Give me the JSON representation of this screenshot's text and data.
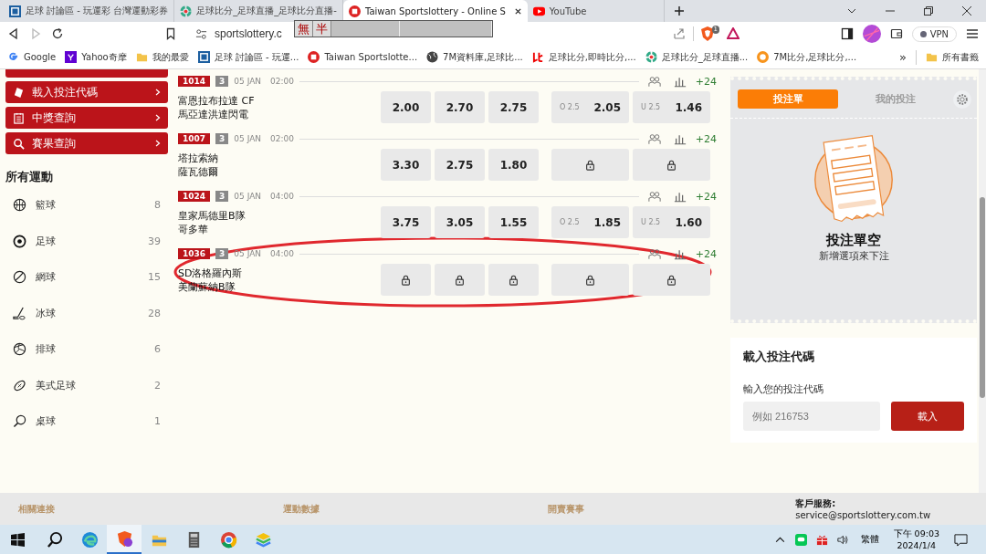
{
  "browser": {
    "tabs": [
      {
        "title": "足球 討論區 - 玩運彩 台灣運動彩券",
        "selected": false
      },
      {
        "title": "足球比分_足球直播_足球比分直播-",
        "selected": false
      },
      {
        "title": "Taiwan Sportslottery - Online S",
        "selected": true
      },
      {
        "title": "YouTube",
        "selected": false
      }
    ],
    "url": "sportslottery.c",
    "shield_count": "1",
    "vpn": "VPN",
    "ime": {
      "mode": "無",
      "width": "半"
    },
    "bookmarks": [
      {
        "label": "Google"
      },
      {
        "label": "Yahoo奇摩"
      },
      {
        "label": "我的最愛"
      },
      {
        "label": "足球 討論區 - 玩運..."
      },
      {
        "label": "Taiwan Sportslotte..."
      },
      {
        "label": "7M資料庫,足球比..."
      },
      {
        "label": "足球比分,即時比分,..."
      },
      {
        "label": "足球比分_足球直播..."
      },
      {
        "label": "7M比分,足球比分,..."
      }
    ],
    "more": "»",
    "all_bookmarks": "所有書籤"
  },
  "sidebar": {
    "menu": [
      {
        "label": "載入投注代碼"
      },
      {
        "label": "中獎查詢"
      },
      {
        "label": "賽果查詢"
      }
    ],
    "sports_title": "所有運動",
    "sports": [
      {
        "name": "籃球",
        "count": "8"
      },
      {
        "name": "足球",
        "count": "39"
      },
      {
        "name": "網球",
        "count": "15"
      },
      {
        "name": "冰球",
        "count": "28"
      },
      {
        "name": "排球",
        "count": "6"
      },
      {
        "name": "美式足球",
        "count": "2"
      },
      {
        "name": "桌球",
        "count": "1"
      }
    ]
  },
  "matches": [
    {
      "code": "1014",
      "tag": "3",
      "date": "05 JAN",
      "time": "02:00",
      "more": "+24",
      "teams": [
        "富恩拉布拉達 CF",
        "馬亞達洪達閃電"
      ],
      "odds": [
        {
          "kind": "odds",
          "value": "2.00"
        },
        {
          "kind": "odds",
          "value": "2.70"
        },
        {
          "kind": "odds",
          "value": "2.75"
        },
        {
          "kind": "line",
          "line": "O 2.5",
          "value": "2.05"
        },
        {
          "kind": "line",
          "line": "U 2.5",
          "value": "1.46"
        }
      ]
    },
    {
      "code": "1007",
      "tag": "3",
      "date": "05 JAN",
      "time": "02:00",
      "more": "+24",
      "teams": [
        "塔拉索納",
        "薩瓦德爾"
      ],
      "odds": [
        {
          "kind": "odds",
          "value": "3.30"
        },
        {
          "kind": "odds",
          "value": "2.75"
        },
        {
          "kind": "odds",
          "value": "1.80"
        },
        {
          "kind": "locked"
        },
        {
          "kind": "locked"
        }
      ]
    },
    {
      "code": "1024",
      "tag": "3",
      "date": "05 JAN",
      "time": "04:00",
      "more": "+24",
      "teams": [
        "皇家馬德里B隊",
        "哥多華"
      ],
      "odds": [
        {
          "kind": "odds",
          "value": "3.75"
        },
        {
          "kind": "odds",
          "value": "3.05"
        },
        {
          "kind": "odds",
          "value": "1.55"
        },
        {
          "kind": "line",
          "line": "O 2.5",
          "value": "1.85"
        },
        {
          "kind": "line",
          "line": "U 2.5",
          "value": "1.60"
        }
      ]
    },
    {
      "code": "1036",
      "tag": "3",
      "date": "05 JAN",
      "time": "04:00",
      "more": "+24",
      "teams": [
        "SD洛格羅內斯",
        "美蘭蘇納B隊"
      ],
      "odds": [
        {
          "kind": "locked"
        },
        {
          "kind": "locked"
        },
        {
          "kind": "locked"
        },
        {
          "kind": "locked"
        },
        {
          "kind": "locked"
        }
      ]
    }
  ],
  "betslip": {
    "tabs": [
      {
        "label": "投注單",
        "selected": true
      },
      {
        "label": "我的投注",
        "selected": false
      }
    ],
    "empty_title": "投注單空",
    "empty_text": "新增選項來下注",
    "code_title": "載入投注代碼",
    "code_label": "輸入您的投注代碼",
    "code_placeholder": "例如 216753",
    "load_button": "載入"
  },
  "footer": {
    "headings": [
      "相關連接",
      "運動數據",
      "開賣賽事"
    ],
    "service_label": "客戶服務:",
    "service_email": "service@sportslottery.com.tw"
  },
  "taskbar": {
    "apps": [
      {
        "active": false
      },
      {
        "active": false
      },
      {
        "active": true
      },
      {
        "active": false
      },
      {
        "active": false
      },
      {
        "active": false
      },
      {
        "active": false
      }
    ],
    "ime": "繁體",
    "time": "下午 09:03",
    "date": "2024/1/4"
  }
}
